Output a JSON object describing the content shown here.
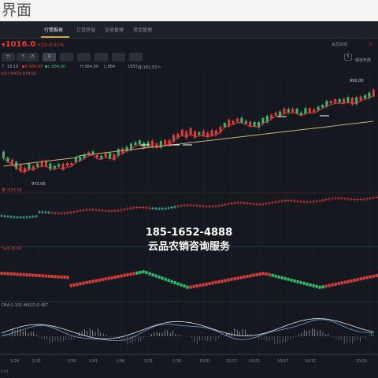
{
  "page": {
    "heading": "界面"
  },
  "tabs": [
    {
      "label": "行情报表",
      "active": true
    },
    {
      "label": "订货终端",
      "active": false
    },
    {
      "label": "交收管理",
      "active": false
    },
    {
      "label": "资金管理",
      "active": false
    }
  ],
  "quote": {
    "price": "1016.0",
    "price_prefix_icon": "down-triangle-icon",
    "change": "+22",
    "change_pct": "-0.51%",
    "account_label": "会员状态:",
    "close_mark": "万"
  },
  "periods": {
    "buttons": [
      "分",
      "5",
      "15",
      "1",
      "",
      "",
      "",
      "",
      "",
      ""
    ],
    "active_index": 3,
    "select_value": "5",
    "save_label": "保存布局"
  },
  "info_row": {
    "items": [
      {
        "label": "7",
        "color": "#9aa0aa"
      },
      {
        "label": "18:10",
        "color": "#9aa0aa"
      },
      {
        "label": "K:984.00",
        "color": "#e23b3b"
      },
      {
        "label": "L:984.00",
        "color": "#2fbf71"
      },
      {
        "label": "H:984.00",
        "color": "#9aa0aa"
      },
      {
        "label": "L:984",
        "color": "#9aa0aa"
      },
      {
        "label": "1953",
        "color": "#9aa0aa"
      },
      {
        "label": "成:192.53 h",
        "color": "#9aa0aa"
      }
    ]
  },
  "ma_label": "5(5) MA55:979.02",
  "main_chart": {
    "high_label": "990.00",
    "low_label": "973.00"
  },
  "indicator1_label": "率 :973.00",
  "indicator2_label": "%e0 |0.60",
  "macd_label": "DEA:1.101  MACD:0.487",
  "x_ticks": [
    "1/28",
    "1/31",
    "1/39",
    "1/41",
    "1/46",
    "1/31",
    "1/38",
    "10/01",
    "10/17",
    "10/21",
    "10/27",
    "10/31",
    "10/31"
  ],
  "corner_time": "0:24",
  "watermark": {
    "phone": "185-1652-4888",
    "company": "云品农销咨询服务"
  },
  "colors": {
    "up": "#e23b3b",
    "down": "#2fbf71",
    "ma_short": "#d93a3a",
    "ma_long": "#c8b27a",
    "background": "#15181e",
    "accent": "#c9a24a"
  }
}
